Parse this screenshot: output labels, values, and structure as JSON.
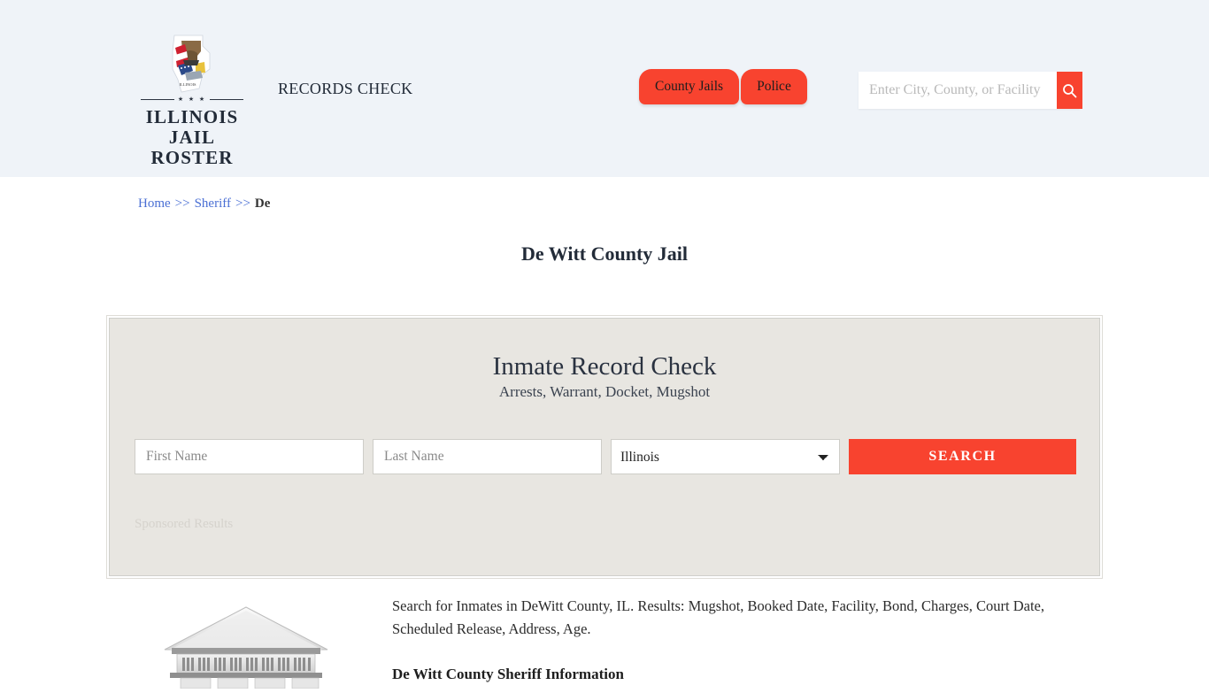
{
  "header": {
    "logo": {
      "icon": "illinois-state-seal-icon",
      "stars": "★ ★ ★",
      "line1": "ILLINOIS",
      "line2": "JAIL ROSTER"
    },
    "tagline": "RECORDS CHECK",
    "nav": [
      {
        "label": "County Jails",
        "name": "nav-tab-county-jails"
      },
      {
        "label": "Police",
        "name": "nav-tab-police"
      }
    ],
    "search": {
      "placeholder": "Enter City, County, or Facility",
      "value": "",
      "button_icon": "search-icon"
    },
    "background_color": "#eff3f8",
    "accent_color": "#f8432f"
  },
  "breadcrumb": {
    "home": "Home",
    "sep1": ">>",
    "sheriff": "Sheriff",
    "sep2": ">>",
    "current": "De"
  },
  "page": {
    "title": "De Witt County Jail"
  },
  "panel": {
    "title": "Inmate Record Check",
    "subtitle": "Arrests, Warrant, Docket, Mugshot",
    "first_name_placeholder": "First Name",
    "first_name_value": "",
    "last_name_placeholder": "Last Name",
    "last_name_value": "",
    "state_selected": "Illinois",
    "state_options": [
      "Illinois"
    ],
    "search_button": "SEARCH",
    "sponsored_label": "Sponsored Results",
    "background_color": "#e8e6e1"
  },
  "content": {
    "illustration": "courthouse-building-icon",
    "paragraph": "Search for Inmates in DeWitt County, IL. Results: Mugshot, Booked Date, Facility, Bond, Charges, Court Date, Scheduled Release, Address, Age.",
    "section_heading": "De Witt County Sheriff Information"
  }
}
